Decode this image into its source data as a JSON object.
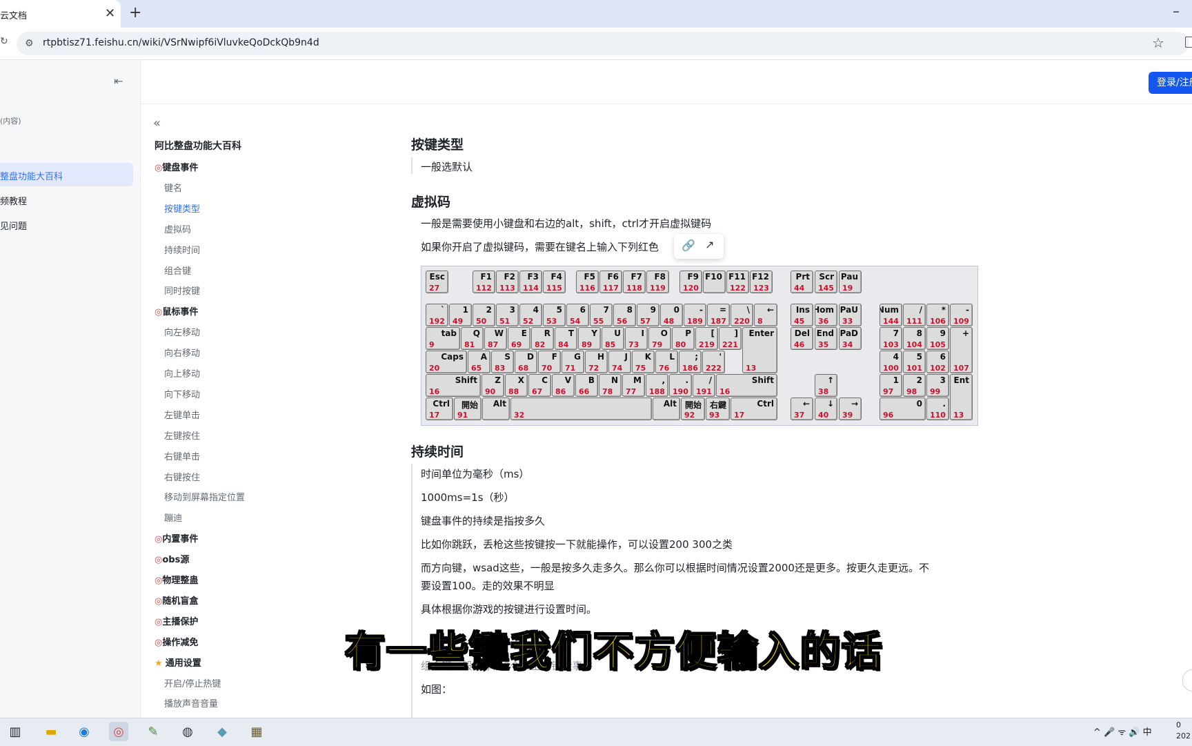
{
  "browser": {
    "tab_title": "云文档",
    "tab_close": "✕",
    "new_tab": "+",
    "minimize": "–",
    "url": "rtpbtisz71.feishu.cn/wiki/VSrNwipf6iVluvkeQoDckQb9n4d"
  },
  "left_sidebar": {
    "hint": "(内容)",
    "items": [
      "整盘功能大百科",
      "频教程",
      "见问题"
    ]
  },
  "header": {
    "login_label": "登录/注册"
  },
  "toc": {
    "title": "阿比整盘功能大百科",
    "items": [
      {
        "label": "键盘事件",
        "level": 1,
        "icon": "target-icon"
      },
      {
        "label": "键名",
        "level": 2
      },
      {
        "label": "按键类型",
        "level": 2,
        "active": true
      },
      {
        "label": "虚拟码",
        "level": 2
      },
      {
        "label": "持续时间",
        "level": 2
      },
      {
        "label": "组合键",
        "level": 2
      },
      {
        "label": "同时按键",
        "level": 2
      },
      {
        "label": "鼠标事件",
        "level": 1,
        "icon": "target-icon"
      },
      {
        "label": "向左移动",
        "level": 2
      },
      {
        "label": "向右移动",
        "level": 2
      },
      {
        "label": "向上移动",
        "level": 2
      },
      {
        "label": "向下移动",
        "level": 2
      },
      {
        "label": "左键单击",
        "level": 2
      },
      {
        "label": "左键按住",
        "level": 2
      },
      {
        "label": "右键单击",
        "level": 2
      },
      {
        "label": "右键按住",
        "level": 2
      },
      {
        "label": "移动到屏幕指定位置",
        "level": 2
      },
      {
        "label": "蹦迪",
        "level": 2
      },
      {
        "label": "内置事件",
        "level": 1,
        "icon": "target-icon"
      },
      {
        "label": "obs源",
        "level": 1,
        "icon": "target-icon"
      },
      {
        "label": "物理整蛊",
        "level": 1,
        "icon": "target-icon"
      },
      {
        "label": "随机盲盒",
        "level": 1,
        "icon": "target-icon"
      },
      {
        "label": "主播保护",
        "level": 1,
        "icon": "target-icon"
      },
      {
        "label": "操作减免",
        "level": 1,
        "icon": "target-icon"
      },
      {
        "label": "通用设置",
        "level": 1,
        "icon": "star-icon"
      },
      {
        "label": "开启/停止热键",
        "level": 2
      },
      {
        "label": "播放声音音量",
        "level": 2
      }
    ]
  },
  "content": {
    "h_key_type": "按键类型",
    "p_key_type": "一般选默认",
    "h_vcode": "虚拟码",
    "p_vcode_1": "一般是需要使用小键盘和右边的alt，shift，ctrl才开启虚拟键码",
    "p_vcode_2": "如果你开启了虚拟键码，需要在键名上输入下列红色",
    "h_duration": "持续时间",
    "p_dur_1": "时间单位为毫秒（ms）",
    "p_dur_2": "1000ms=1s（秒）",
    "p_dur_3": "键盘事件的持续是指按多久",
    "p_dur_4": "比如你跳跃，丢枪这些按键按一下就能操作，可以设置200 300之类",
    "p_dur_5a": "而方向键，wsad这些，一般是按多久走多久。那么你可以根据时间情况设置2000还是更多。按更久走更远。不",
    "p_dur_5b": "要设置100。走的效果不明显",
    "p_dur_6": "具体根据你游戏的按键进行设置时间。",
    "p_combo_1": "组合键一般是添加2个以上的键盘事件",
    "p_combo_2": "如图："
  },
  "keyboard": {
    "keys": [
      [
        "Esc",
        "27"
      ],
      [
        "F1",
        "112"
      ],
      [
        "F2",
        "113"
      ],
      [
        "F3",
        "114"
      ],
      [
        "F4",
        "115"
      ],
      [
        "F5",
        "116"
      ],
      [
        "F6",
        "117"
      ],
      [
        "F7",
        "118"
      ],
      [
        "F8",
        "119"
      ],
      [
        "F9",
        "120"
      ],
      [
        "F10",
        ""
      ],
      [
        "F11",
        "122"
      ],
      [
        "F12",
        "123"
      ],
      [
        "Prt",
        "44"
      ],
      [
        "Scr",
        "145"
      ],
      [
        "Pau",
        "19"
      ],
      [
        "`",
        "192"
      ],
      [
        "1",
        "49"
      ],
      [
        "2",
        "50"
      ],
      [
        "3",
        "51"
      ],
      [
        "4",
        "52"
      ],
      [
        "5",
        "53"
      ],
      [
        "6",
        "54"
      ],
      [
        "7",
        "55"
      ],
      [
        "8",
        "56"
      ],
      [
        "9",
        "57"
      ],
      [
        "0",
        "48"
      ],
      [
        "-",
        "189"
      ],
      [
        "=",
        "187"
      ],
      [
        "\\",
        "220"
      ],
      [
        "←",
        "8"
      ],
      [
        "Ins",
        "45"
      ],
      [
        "Hom",
        "36"
      ],
      [
        "PaU",
        "33"
      ],
      [
        "Num",
        "144"
      ],
      [
        "/",
        "111"
      ],
      [
        "*",
        "106"
      ],
      [
        "-",
        "109"
      ],
      [
        "tab",
        "9"
      ],
      [
        "Q",
        "81"
      ],
      [
        "W",
        "87"
      ],
      [
        "E",
        "69"
      ],
      [
        "R",
        "82"
      ],
      [
        "T",
        "84"
      ],
      [
        "Y",
        "89"
      ],
      [
        "U",
        "85"
      ],
      [
        "I",
        "73"
      ],
      [
        "O",
        "79"
      ],
      [
        "P",
        "80"
      ],
      [
        "[",
        "219"
      ],
      [
        "]",
        "221"
      ],
      [
        "Enter",
        "13"
      ],
      [
        "Del",
        "46"
      ],
      [
        "End",
        "35"
      ],
      [
        "PaD",
        "34"
      ],
      [
        "7",
        "103"
      ],
      [
        "8",
        "104"
      ],
      [
        "9",
        "105"
      ],
      [
        "+",
        "107"
      ],
      [
        "Caps",
        "20"
      ],
      [
        "A",
        "65"
      ],
      [
        "S",
        "83"
      ],
      [
        "D",
        "68"
      ],
      [
        "F",
        "70"
      ],
      [
        "G",
        "71"
      ],
      [
        "H",
        "72"
      ],
      [
        "J",
        "74"
      ],
      [
        "K",
        "75"
      ],
      [
        "L",
        "76"
      ],
      [
        ";",
        "186"
      ],
      [
        "'",
        "222"
      ],
      [
        "4",
        "100"
      ],
      [
        "5",
        "101"
      ],
      [
        "6",
        "102"
      ],
      [
        "Shift",
        "16"
      ],
      [
        "Z",
        "90"
      ],
      [
        "X",
        "88"
      ],
      [
        "C",
        "67"
      ],
      [
        "V",
        "86"
      ],
      [
        "B",
        "66"
      ],
      [
        "N",
        "78"
      ],
      [
        "M",
        "77"
      ],
      [
        ",",
        "188"
      ],
      [
        ".",
        "190"
      ],
      [
        "/",
        "191"
      ],
      [
        "Shift",
        "16"
      ],
      [
        "↑",
        "38"
      ],
      [
        "1",
        "97"
      ],
      [
        "2",
        "98"
      ],
      [
        "3",
        "99"
      ],
      [
        "Ent",
        "13"
      ],
      [
        "Ctrl",
        "17"
      ],
      [
        "開始",
        "91"
      ],
      [
        "Alt",
        ""
      ],
      [
        "",
        "32"
      ],
      [
        "Alt",
        ""
      ],
      [
        "開始",
        "92"
      ],
      [
        "右鍵",
        "93"
      ],
      [
        "Ctrl",
        "17"
      ],
      [
        "←",
        "37"
      ],
      [
        "↓",
        "40"
      ],
      [
        "→",
        "39"
      ],
      [
        "0",
        "96"
      ],
      [
        ".",
        "110"
      ]
    ]
  },
  "subtitle": "有一些键我们不方便输入的话",
  "taskbar": {
    "tray_text": "^  🎤  ᯤ  🔊  中",
    "time_line1": "0",
    "time_line2": "202"
  }
}
